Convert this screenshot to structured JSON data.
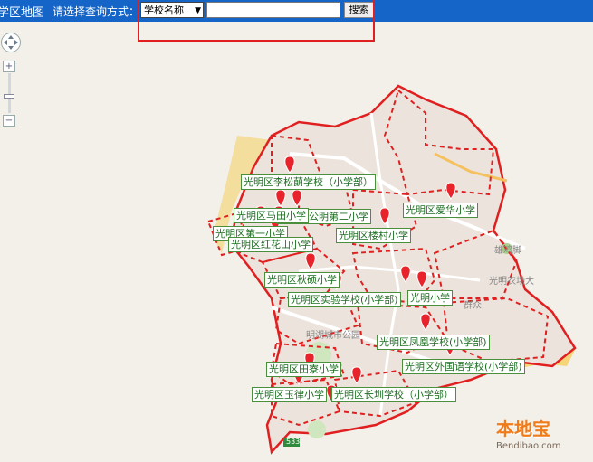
{
  "header": {
    "title": "学区地图",
    "query_label": "请选择查询方式：",
    "select_value": "学校名称",
    "search_value": "",
    "search_button": "搜索"
  },
  "map_text": {
    "place1": "雄鸡脚",
    "place2": "光明农场大",
    "place3": "群众",
    "place4": "明湖城市公园",
    "road": "533"
  },
  "schools": [
    "光明区李松蓢学校（小学部）",
    "光明区公明第二小学",
    "光明区爱华小学",
    "光明区马田小学",
    "光明区第一小学",
    "光明区红花山小学",
    "光明区楼村小学",
    "光明区秋硕小学",
    "光明区实验学校(小学部)",
    "光明小学",
    "光明区凤凰学校(小学部)",
    "光明区外国语学校(小学部)",
    "光明区田寮小学",
    "光明区玉律小学",
    "光明区长圳学校（小学部）"
  ],
  "watermark": {
    "brand": "本地宝",
    "url": "Bendibao.com"
  },
  "colors": {
    "header_bg": "#1565c8",
    "boundary": "#e02020",
    "marker": "#e8232b",
    "label_text": "#1e6e22",
    "highlight": "#f5d26a"
  }
}
